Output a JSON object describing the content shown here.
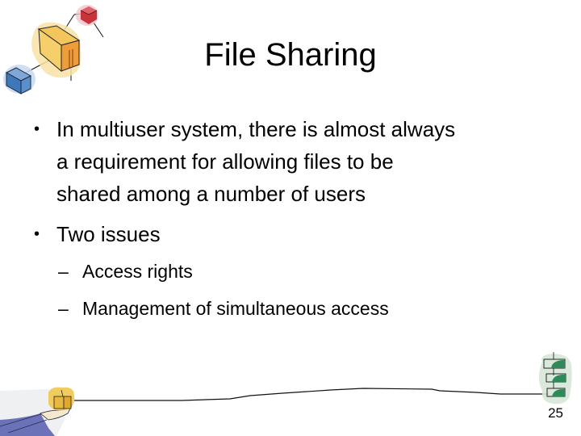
{
  "slide": {
    "title": "File Sharing",
    "bullets": [
      {
        "text": "In multiuser system, there is almost always a requirement for allowing files to be shared among a number of users",
        "lines": [
          "In multiuser system, there is almost always",
          "a requirement for allowing files to be",
          "shared among a number of users"
        ],
        "marker": "•"
      },
      {
        "text": "Two issues",
        "lines": [
          "Two issues"
        ],
        "marker": "•",
        "subitems": [
          {
            "marker": "–",
            "text": "Access rights"
          },
          {
            "marker": "–",
            "text": "Management of simultaneous access"
          }
        ]
      }
    ],
    "page_number": "25"
  },
  "decorations": {
    "top_left": "network-cubes-clipart",
    "bottom_left": "hand-holding-box-clipart",
    "bottom_right": "stacked-green-boxes-clipart",
    "colors": {
      "yellow_box": "#f2c65a",
      "orange_box": "#ef9c3a",
      "red_cube": "#c8343a",
      "blue_cube": "#3f78b8",
      "green_boxes": "#2f8a5a",
      "sleeve": "#6b72b8"
    }
  }
}
